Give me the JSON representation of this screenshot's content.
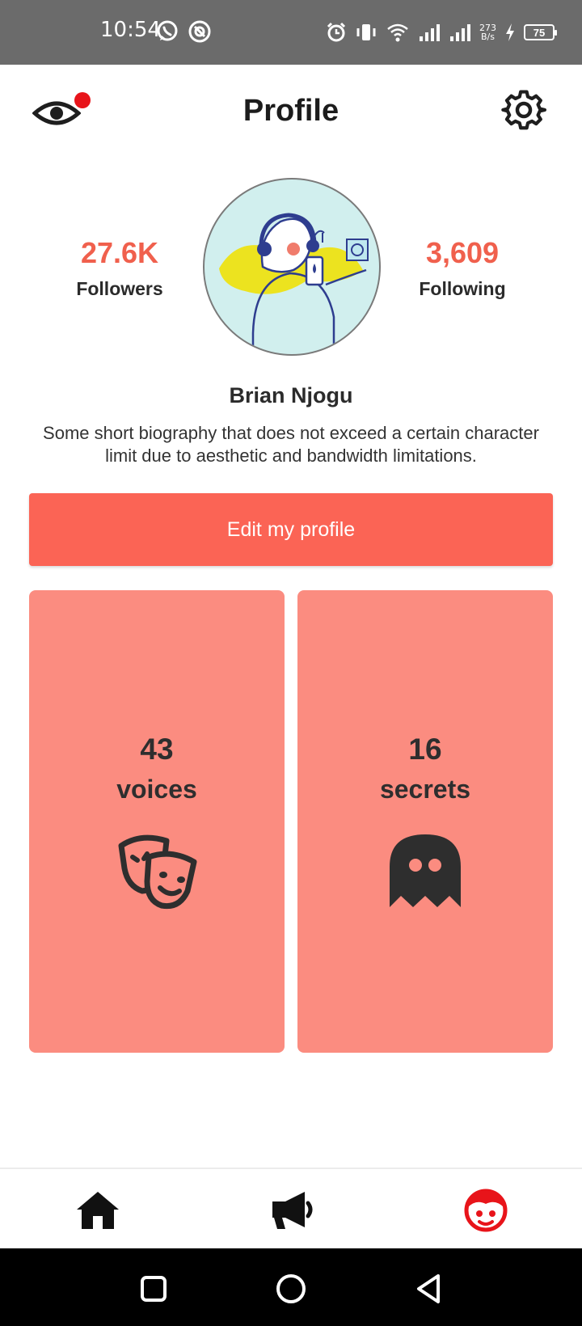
{
  "status_bar": {
    "time": "10:54",
    "net_speed_value": "273",
    "net_speed_unit": "B/s",
    "battery": "75",
    "icons": [
      "whatsapp-icon",
      "at-sign-icon",
      "alarm-icon",
      "vibrate-icon",
      "wifi-icon",
      "signal-icon",
      "signal-icon",
      "charging-icon",
      "battery-icon"
    ]
  },
  "header": {
    "title": "Profile",
    "left_icon": "eye-icon",
    "right_icon": "gear-icon",
    "notification_dot_color": "#e8141a"
  },
  "profile": {
    "followers_value": "27.6K",
    "followers_label": "Followers",
    "following_value": "3,609",
    "following_label": "Following",
    "name": "Brian Njogu",
    "bio": "Some short biography that does not exceed a certain character limit due to aesthetic and bandwidth limitations.",
    "edit_button": "Edit my profile"
  },
  "cards": [
    {
      "count": "43",
      "label": "voices",
      "icon": "theater-masks-icon"
    },
    {
      "count": "16",
      "label": "secrets",
      "icon": "ghost-icon"
    }
  ],
  "bottom_nav": [
    {
      "icon": "home-icon",
      "active": false
    },
    {
      "icon": "megaphone-icon",
      "active": false
    },
    {
      "icon": "face-icon",
      "active": true
    }
  ],
  "system_nav": [
    "square-icon",
    "circle-icon",
    "back-triangle-icon"
  ],
  "colors": {
    "accent": "#fb6455",
    "card": "#fb8c80",
    "stat_value": "#f0604d",
    "active_nav": "#e8141a"
  }
}
